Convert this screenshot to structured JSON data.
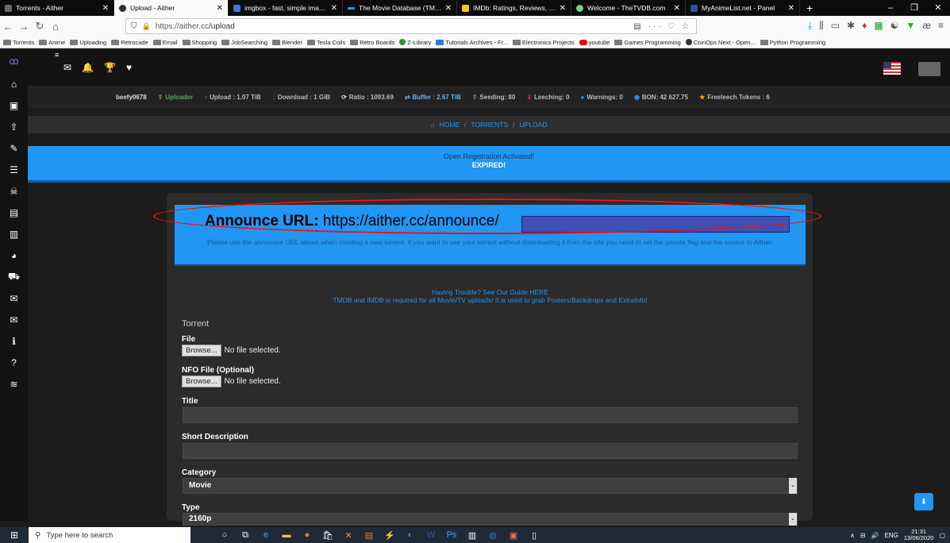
{
  "browser": {
    "tabs": [
      {
        "title": "Torrents - Aither",
        "active": false,
        "favicon_color": "#6a6a6a"
      },
      {
        "title": "Upload - Aither",
        "active": true,
        "favicon_color": "#333333"
      },
      {
        "title": "imgbox - fast, simple image ho",
        "active": false,
        "favicon_color": "#3b7bd4"
      },
      {
        "title": "The Movie Database (TMDb)",
        "active": false,
        "favicon_color": "#01b4e4"
      },
      {
        "title": "IMDb: Ratings, Reviews, and W",
        "active": false,
        "favicon_color": "#f5c518"
      },
      {
        "title": "Welcome - TheTVDB.com",
        "active": false,
        "favicon_color": "#6cd491"
      },
      {
        "title": "MyAnimeList.net - Panel",
        "active": false,
        "favicon_color": "#2e51a2"
      }
    ],
    "url_scheme_host": "https://aither.cc",
    "url_path": "/upload",
    "bookmarks": [
      "Torrents",
      "Anime",
      "Uploading",
      "Retrocade",
      "Email",
      "Shopping",
      "JobSearching",
      "Blender",
      "Tesla Coils",
      "Retro Boards",
      "Z-Library",
      "Tutorials Archives - Fr...",
      "Electronics Projects",
      "youtube",
      "Games Programming",
      "CoinOps Next - Open...",
      "Python Programming"
    ]
  },
  "stats": {
    "username": "beefy0678",
    "rank": "Uploader",
    "upload": "Upload : 1.07 TiB",
    "download": "Download : 1 GiB",
    "ratio": "Ratio : 1093.69",
    "buffer": "Buffer : 2.67 TiB",
    "seeding": "Seeding: 80",
    "leeching": "Leeching: 0",
    "warnings": "Warnings: 0",
    "bon": "BON: 42 627.75",
    "freeleech": "Freeleech Tokens : 6"
  },
  "breadcrumb": {
    "home": "HOME",
    "sep": "/",
    "torrents": "TORRENTS",
    "upload": "UPLOAD"
  },
  "registration": {
    "line1": "Open Registration Activated!",
    "line2": "EXPIRED!"
  },
  "announce": {
    "label": "Announce URL:",
    "url": "https://aither.cc/announce/",
    "note": "Please use the announce URL above when creating a new torrent. If you want to use your torrent without downloading it from the site you need to set the private flag and the source to Aither."
  },
  "help": {
    "line1": "Having Trouble? See Our Guide HERE",
    "line2": "TMDB and IMDB is required for all Movie/TV uploads! It is used to grab Posters/Backdrops and ExtraInfo!"
  },
  "form": {
    "section": "Torrent",
    "file_label": "File",
    "nfo_label": "NFO File (Optional)",
    "browse": "Browse...",
    "no_file": "No file selected.",
    "title_label": "Title",
    "short_desc_label": "Short Description",
    "category_label": "Category",
    "category_value": "Movie",
    "type_label": "Type",
    "type_value": "2160p"
  },
  "taskbar": {
    "search_placeholder": "Type here to search",
    "lang": "ENG",
    "time": "21:31",
    "date": "13/06/2020"
  }
}
